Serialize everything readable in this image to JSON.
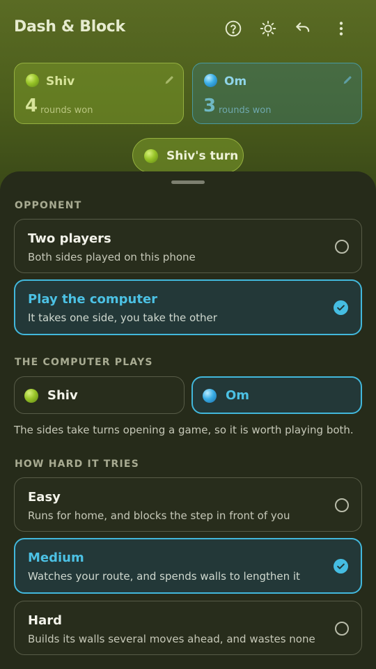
{
  "app": {
    "title": "Dash & Block"
  },
  "toolbar": {
    "icons": [
      "help-icon",
      "theme-icon",
      "undo-icon",
      "more-vert-icon"
    ]
  },
  "scores": [
    {
      "name": "Shiv",
      "rounds": "4",
      "label": "rounds won",
      "color": "#98c428"
    },
    {
      "name": "Om",
      "rounds": "3",
      "label": "rounds won",
      "color": "#3aaee6"
    }
  ],
  "turn": {
    "label": "Shiv's turn"
  },
  "opponent": {
    "title": "OPPONENT",
    "options": [
      {
        "title": "Two players",
        "subtitle": "Both sides played on this phone",
        "selected": false
      },
      {
        "title": "Play the computer",
        "subtitle": "It takes one side, you take the other",
        "selected": true
      }
    ]
  },
  "computer_plays": {
    "title": "THE COMPUTER PLAYS",
    "sides": [
      {
        "label": "Shiv",
        "selected": false
      },
      {
        "label": "Om",
        "selected": true
      }
    ],
    "hint": "The sides take turns opening a game, so it is worth playing both."
  },
  "difficulty": {
    "title": "HOW HARD IT TRIES",
    "options": [
      {
        "title": "Easy",
        "subtitle": "Runs for home, and blocks the step in front of you",
        "selected": false
      },
      {
        "title": "Medium",
        "subtitle": "Watches your route, and spends walls to lengthen it",
        "selected": true
      },
      {
        "title": "Hard",
        "subtitle": "Builds its walls several moves ahead, and wastes none",
        "selected": false
      }
    ]
  },
  "colors": {
    "accent": "#42b8dc",
    "sheet": "#262b1a",
    "green": "#98c428"
  }
}
